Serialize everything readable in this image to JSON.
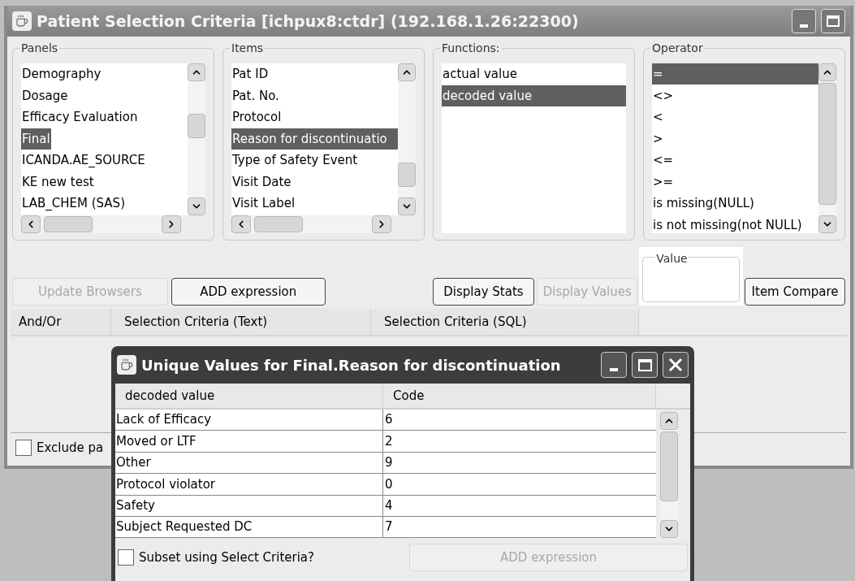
{
  "window": {
    "title": "Patient Selection Criteria [ichpux8:ctdr] (192.168.1.26:22300)"
  },
  "groups": [
    {
      "label": "Panels",
      "kind": "list_hscroll",
      "items": [
        {
          "text": "Demography",
          "selected": false
        },
        {
          "text": "Dosage",
          "selected": false
        },
        {
          "text": "Efficacy Evaluation",
          "selected": false
        },
        {
          "text": "Final",
          "selected": true
        },
        {
          "text": "ICANDA.AE_SOURCE",
          "selected": false
        },
        {
          "text": "KE new test",
          "selected": false
        },
        {
          "text": "LAB_CHEM (SAS)",
          "selected": false
        }
      ]
    },
    {
      "label": "Items",
      "kind": "list_hscroll",
      "items": [
        {
          "text": "Pat ID",
          "selected": false
        },
        {
          "text": "Pat. No.",
          "selected": false
        },
        {
          "text": "Protocol",
          "selected": false
        },
        {
          "text": "Reason for discontinuatio",
          "selected": true
        },
        {
          "text": "Type of Safety Event",
          "selected": false
        },
        {
          "text": "Visit Date",
          "selected": false
        },
        {
          "text": "Visit Label",
          "selected": false
        }
      ]
    },
    {
      "label": "Functions:",
      "kind": "list",
      "items": [
        {
          "text": "actual value",
          "selected": false
        },
        {
          "text": "decoded value",
          "selected": true
        }
      ]
    },
    {
      "label": "Operator",
      "kind": "list_vscroll",
      "items": [
        {
          "text": "=",
          "selected": true
        },
        {
          "text": "<>",
          "selected": false
        },
        {
          "text": "<",
          "selected": false
        },
        {
          "text": ">",
          "selected": false
        },
        {
          "text": "<=",
          "selected": false
        },
        {
          "text": ">=",
          "selected": false
        },
        {
          "text": "is missing(NULL)",
          "selected": false
        },
        {
          "text": "is not missing(not NULL)",
          "selected": false
        }
      ]
    }
  ],
  "left_buttons": [
    {
      "label": "Update Browsers",
      "disabled": true
    },
    {
      "label": "ADD expression",
      "disabled": false
    }
  ],
  "right_buttons": [
    {
      "label": "Display Stats",
      "disabled": false
    },
    {
      "label": "Display Values",
      "disabled": true
    }
  ],
  "value_box": {
    "label": "Value"
  },
  "compare_button": {
    "label": "Item Compare",
    "disabled": false
  },
  "criteria_table": {
    "columns": [
      "And/Or",
      "Selection Criteria (Text)",
      "Selection Criteria (SQL)"
    ]
  },
  "exclude": {
    "label": "Exclude pa",
    "checked": false
  },
  "dialog": {
    "title": "Unique Values for Final.Reason for discontinuation",
    "columns": [
      "decoded value",
      "Code"
    ],
    "rows": [
      [
        "Lack of Efficacy",
        "6"
      ],
      [
        "Moved or LTF",
        "2"
      ],
      [
        "Other",
        "9"
      ],
      [
        "Protocol violator",
        "0"
      ],
      [
        "Safety",
        "4"
      ],
      [
        "Subject Requested DC",
        "7"
      ]
    ],
    "subset": {
      "label": "Subset using Select Criteria?",
      "checked": false
    },
    "add_button": {
      "label": "ADD expression",
      "disabled": true
    }
  }
}
